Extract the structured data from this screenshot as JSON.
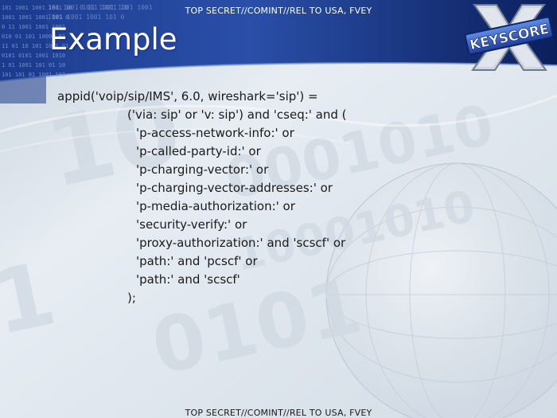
{
  "classification": {
    "top": "TOP SECRET//COMINT//REL TO USA, FVEY",
    "bottom": "TOP SECRET//COMINT//REL TO USA, FVEY"
  },
  "header": {
    "title": "Example"
  },
  "logo": {
    "text": "KEYSCORE",
    "letter": "X"
  },
  "background": {
    "binary_strips": [
      "101 1001 1001 1001 10",
      "1001 1001 1001 101 0",
      "0 11 1001 1001 1001",
      "010 01 101 10001 01",
      "11 01 10 101 1001 01",
      "0101 0101 1001 1010",
      "1 01 1001 101 01 10",
      "101 101 01 1001 101"
    ],
    "colors": {
      "header_blue": "#2a4fa8",
      "header_dark": "#0b1f5c",
      "body_light": "#e7edf3",
      "body_mid": "#c9d3de"
    }
  },
  "code": {
    "lines": [
      "appid('voip/sip/IMS', 6.0, wireshark='sip') =",
      "('via: sip' or 'v: sip') and 'cseq:' and (",
      "'p-access-network-info:' or",
      "'p-called-party-id:' or",
      "'p-charging-vector:' or",
      "'p-charging-vector-addresses:' or",
      "'p-media-authorization:' or",
      "'security-verify:' or",
      "'proxy-authorization:' and 'scscf' or",
      "'path:' and 'pcscf' or",
      "'path:' and 'scscf'",
      ");"
    ]
  }
}
